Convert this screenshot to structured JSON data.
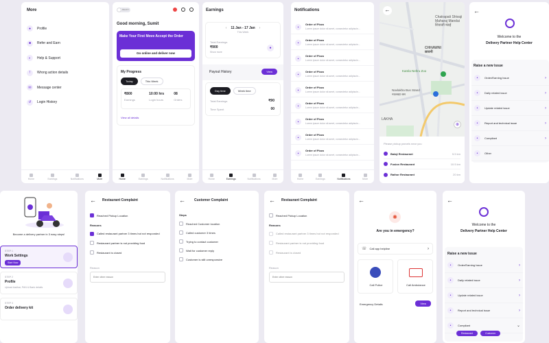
{
  "colors": {
    "accent": "#6b2fd6",
    "dark": "#1c1c22"
  },
  "nav": {
    "home": "Home",
    "earnings": "Earnings",
    "notifications": "Notifications",
    "more": "More"
  },
  "more": {
    "title": "More",
    "items": [
      {
        "label": "Profile",
        "icon": "person-icon"
      },
      {
        "label": "Refer and Earn",
        "icon": "gift-icon"
      },
      {
        "label": "Help & Support",
        "icon": "headset-icon"
      },
      {
        "label": "Wrong action details",
        "icon": "alert-icon"
      },
      {
        "label": "Message center",
        "icon": "message-icon"
      },
      {
        "label": "Login History",
        "icon": "history-icon"
      }
    ]
  },
  "home": {
    "toggle": "READY",
    "greeting": "Good morning, Sumit",
    "banner_title": "Make Your First Move  Accept the Order",
    "banner_button": "Go online and deliver now",
    "progress_title": "My Progress",
    "tab_today": "Today",
    "tab_week": "This Week",
    "stats": [
      {
        "value": "₹800",
        "label": "Earnings"
      },
      {
        "value": "10:00 hrs",
        "label": "Login hours"
      },
      {
        "value": "08",
        "label": "Orders"
      }
    ],
    "view_all": "View all details"
  },
  "earnings": {
    "title": "Earnings",
    "date_range": "11 Jan - 17 Jan",
    "date_sub": "This Week",
    "total_label": "Total Earnings",
    "total_value": "₹900",
    "show_more": "Show more",
    "payout_label": "Payout History",
    "payout_button": "View",
    "tab_day": "Day time",
    "tab_week": "Week time",
    "day_total_label": "Total Earnings",
    "day_total_value": "₹90",
    "time_spent_label": "Time Spent",
    "time_spent_value": "00"
  },
  "notifications": {
    "title": "Notifications",
    "item_title": "Order of Pizza",
    "item_body": "Lorem ipsum dolor sit amet, consectetur adipiscin..."
  },
  "map": {
    "labels": [
      "Chatrapati Shivaji",
      "Maharaj Mandai",
      "शिवाजी मंडई",
      "CHHAWNI",
      "छावनी",
      "Kamla Nehru Zoo",
      "Navlakha Bus Stand",
      "नवलखा बस",
      "LAKHA"
    ],
    "prompt": "Please pickup parcels near you",
    "pickups": [
      {
        "name": "Balaji Restaurant",
        "dist": "5.5 km"
      },
      {
        "name": "Fusion Restaurant",
        "dist": "10.5 km"
      },
      {
        "name": "Rathor Restaurant",
        "dist": "20 km"
      }
    ]
  },
  "help1": {
    "welcome": "Welcome to the",
    "title": "Delivery Partner Help Center",
    "raise": "Raise a new issue",
    "items": [
      "Order/Earning Issue",
      "Daily related issue",
      "Update related issue",
      "Report and technical issue",
      "Compliant",
      "Other"
    ]
  },
  "onboard": {
    "caption": "Become a delivery partner in 3 easy steps!",
    "steps": [
      {
        "step": "STEP 1",
        "title": "Work Settings",
        "button": "Start Now"
      },
      {
        "step": "STEP 2",
        "title": "Profile",
        "sub": "Upload Aadhar, PAN & Bank details"
      },
      {
        "step": "STEP 3",
        "title": "Order delivery kit"
      }
    ]
  },
  "rc1": {
    "title": "Restaurant Complaint",
    "reached": "Reached Pickup Location",
    "reasons_label": "Reasons",
    "reasons": [
      "Called restaurant partner 3 times but not responded",
      "Restaurant partner is not providing food",
      "Restaurant is closed"
    ],
    "reason_label": "Reason",
    "reason_placeholder": "Enter other reason"
  },
  "cc": {
    "title": "Customer Complaint",
    "steps_label": "Steps",
    "steps": [
      "Reached Customer location",
      "Called customer 3 times",
      "Trying to contact customer",
      "Wait for customer reply",
      "Customer is still unresponsive"
    ]
  },
  "rc2": {
    "title": "Restaurant Complaint",
    "reached": "Reached Pickup Location",
    "reasons_label": "Reasons",
    "reasons": [
      "Called restaurant partner 3 times but not responded",
      "Restaurant partner is not providing food",
      "Restaurant is closed"
    ],
    "reason_label": "Reason",
    "reason_placeholder": "Enter other reason"
  },
  "emergency": {
    "title": "Are you in emergency?",
    "helpline": "Call app helpline",
    "police": "Call Police",
    "ambulance": "Call Ambulance",
    "details": "Emergency Details",
    "details_button": "View"
  },
  "help2": {
    "welcome": "Welcome to the",
    "title": "Delivery Partner Help Center",
    "raise": "Raise a new issue",
    "items": [
      "Order/Earning Issue",
      "Daily related issue",
      "Update related issue",
      "Report and technical issue",
      "Compliant"
    ],
    "chip1": "Restaurant",
    "chip2": "Customer"
  }
}
